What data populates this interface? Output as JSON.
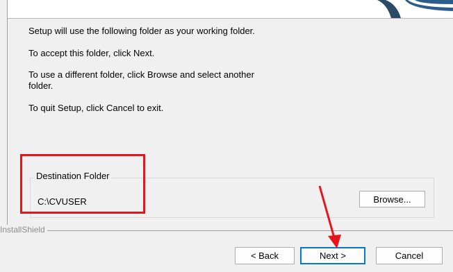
{
  "instructions": {
    "line1": "Setup will use the following folder as your working folder.",
    "line2": "To accept this folder, click Next.",
    "line3a": "To use a different folder, click Browse and select another",
    "line3b": "folder.",
    "line4": "To quit Setup, click Cancel to exit."
  },
  "destination": {
    "legend": "Destination Folder",
    "path": "C:\\CVUSER",
    "browse_label": "Browse..."
  },
  "footer": {
    "brand": "InstallShield",
    "back_label": "< Back",
    "next_label": "Next >",
    "cancel_label": "Cancel"
  },
  "colors": {
    "highlight": "#e8141c",
    "default_button_border": "#0078d4"
  }
}
